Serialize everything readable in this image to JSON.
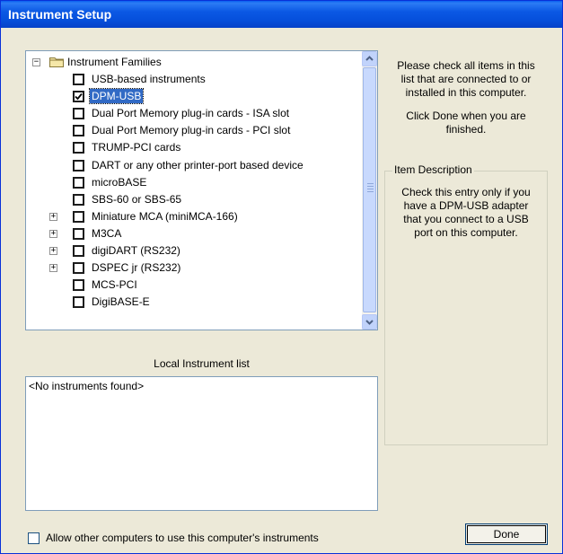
{
  "window": {
    "title": "Instrument Setup"
  },
  "tree": {
    "root": "Instrument Families",
    "items": [
      {
        "label": "USB-based instruments",
        "checked": false,
        "expandable": false,
        "selected": false
      },
      {
        "label": "DPM-USB",
        "checked": true,
        "expandable": false,
        "selected": true
      },
      {
        "label": "Dual Port Memory plug-in cards - ISA slot",
        "checked": false,
        "expandable": false,
        "selected": false
      },
      {
        "label": "Dual Port Memory plug-in cards - PCI slot",
        "checked": false,
        "expandable": false,
        "selected": false
      },
      {
        "label": "TRUMP-PCI cards",
        "checked": false,
        "expandable": false,
        "selected": false
      },
      {
        "label": "DART or any other printer-port based device",
        "checked": false,
        "expandable": false,
        "selected": false
      },
      {
        "label": "microBASE",
        "checked": false,
        "expandable": false,
        "selected": false
      },
      {
        "label": "SBS-60 or SBS-65",
        "checked": false,
        "expandable": false,
        "selected": false
      },
      {
        "label": "Miniature MCA (miniMCA-166)",
        "checked": false,
        "expandable": true,
        "selected": false
      },
      {
        "label": "M3CA",
        "checked": false,
        "expandable": true,
        "selected": false
      },
      {
        "label": "digiDART (RS232)",
        "checked": false,
        "expandable": true,
        "selected": false
      },
      {
        "label": "DSPEC jr (RS232)",
        "checked": false,
        "expandable": true,
        "selected": false
      },
      {
        "label": "MCS-PCI",
        "checked": false,
        "expandable": false,
        "selected": false
      },
      {
        "label": "DigiBASE-E",
        "checked": false,
        "expandable": false,
        "selected": false
      }
    ]
  },
  "instructions": {
    "line1": "Please check all items in this",
    "line2": "list that are connected to or",
    "line3": "installed in this computer.",
    "line4": "Click Done when you are",
    "line5": "finished."
  },
  "item_description": {
    "title": "Item Description",
    "line1": "Check this entry only if you",
    "line2": "have a DPM-USB adapter",
    "line3": "that you connect to a USB",
    "line4": "port on this computer."
  },
  "local_list": {
    "caption": "Local Instrument list",
    "empty_text": "<No instruments found>"
  },
  "allow_sharing": {
    "label": "Allow other computers to use this computer's instruments",
    "checked": false
  },
  "done_button": {
    "label": "Done"
  },
  "icons": {
    "expand": "plus-box-icon",
    "collapse": "minus-box-icon",
    "folder": "folder-icon",
    "scroll_up": "chevron-up-icon",
    "scroll_down": "chevron-down-icon"
  }
}
